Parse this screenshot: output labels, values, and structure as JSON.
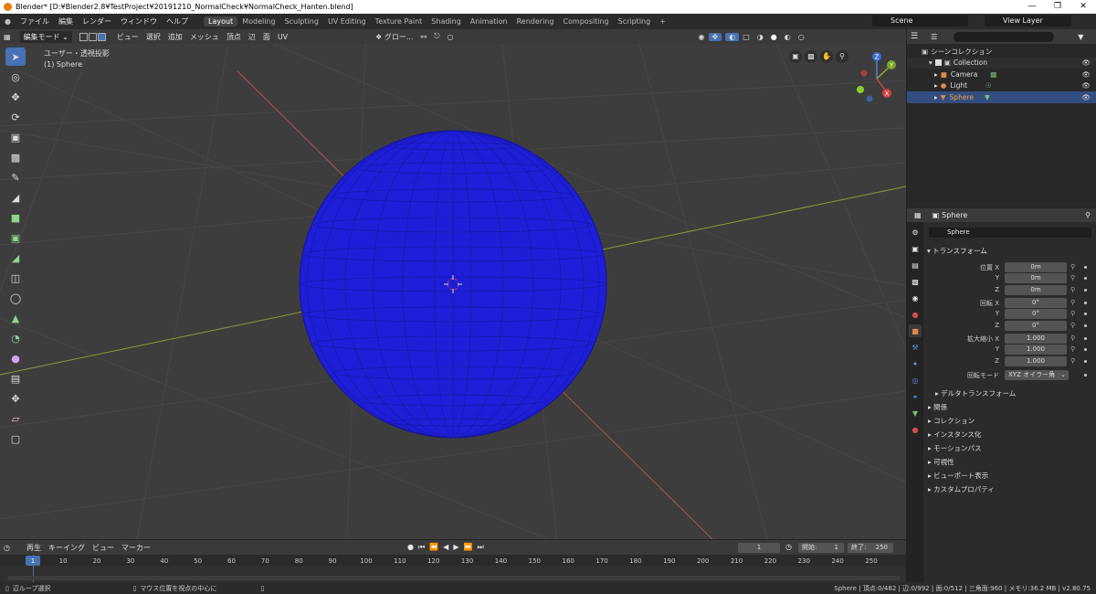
{
  "title": "Blender* [D:¥Blender2.8¥TestProject¥20191210_NormalCheck¥NormalCheck_Hanten.blend]",
  "menu": [
    "ファイル",
    "編集",
    "レンダー",
    "ウィンドウ",
    "ヘルプ"
  ],
  "workspaces": [
    "Layout",
    "Modeling",
    "Sculpting",
    "UV Editing",
    "Texture Paint",
    "Shading",
    "Animation",
    "Rendering",
    "Compositing",
    "Scripting",
    "+"
  ],
  "scene": "Scene",
  "view_layer": "View Layer",
  "viewport_header": {
    "mode": "編集モード",
    "items": [
      "ビュー",
      "選択",
      "追加",
      "メッシュ",
      "頂点",
      "辺",
      "面",
      "UV"
    ],
    "transform": "グロー..."
  },
  "viewport": {
    "view_name": "ユーザー・透視投影",
    "object_name": "(1) Sphere",
    "sphere_color": "#1e1ed8",
    "gizmo": {
      "z": "Z",
      "y": "Y",
      "x": "X"
    }
  },
  "outliner": {
    "root": "シーンコレクション",
    "collection": "Collection",
    "items": [
      {
        "name": "Camera",
        "icon": "camera-icon"
      },
      {
        "name": "Light",
        "icon": "light-icon"
      },
      {
        "name": "Sphere",
        "icon": "mesh-icon",
        "active": true
      }
    ]
  },
  "properties": {
    "header": "Sphere",
    "name_field": "Sphere",
    "transform_title": "トランスフォーム",
    "location": {
      "label": "位置 X",
      "x": "0m",
      "y": "0m",
      "z": "0m"
    },
    "rotation": {
      "label": "回転 X",
      "x": "0°",
      "y": "0°",
      "z": "0°"
    },
    "scale": {
      "label": "拡大縮小 X",
      "x": "1.000",
      "y": "1.000",
      "z": "1.000"
    },
    "axis_y": "Y",
    "axis_z": "Z",
    "rotation_mode_label": "回転モード",
    "rotation_mode": "XYZ オイラー角",
    "delta": "デルタトランスフォーム",
    "sections": [
      "関係",
      "コレクション",
      "インスタンス化",
      "モーションパス",
      "可視性",
      "ビューポート表示",
      "カスタムプロパティ"
    ]
  },
  "timeline_header": {
    "items": [
      "再生",
      "キーイング",
      "ビュー",
      "マーカー"
    ],
    "current_frame": "1",
    "start_label": "開始:",
    "start": "1",
    "end_label": "終了:",
    "end": "250"
  },
  "timeline_ticks": [
    "1",
    "10",
    "20",
    "30",
    "40",
    "50",
    "60",
    "70",
    "80",
    "90",
    "100",
    "110",
    "120",
    "130",
    "140",
    "150",
    "160",
    "170",
    "180",
    "190",
    "200",
    "210",
    "220",
    "230",
    "240",
    "250"
  ],
  "status": {
    "left": "辺ループ選択",
    "middle": "マウス位置を視点の中心に",
    "right": "Sphere | 頂点:0/482 | 辺:0/992 | 面:0/512 | 三角面:960 | メモリ:36.2 MB | v2.80.75"
  }
}
